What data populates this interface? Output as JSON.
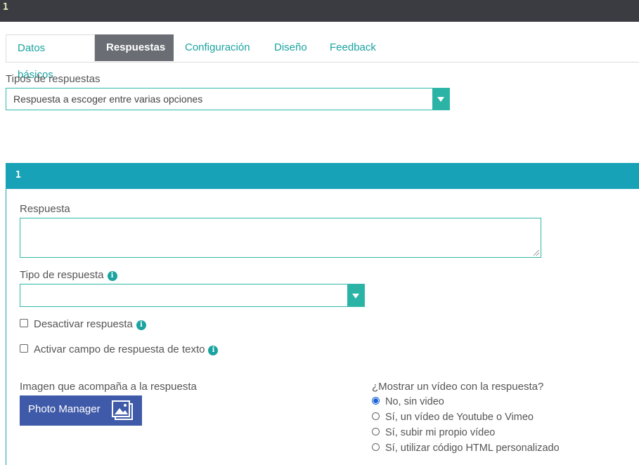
{
  "topbar": {
    "number": "1"
  },
  "tabs": [
    {
      "label": "Datos básicos"
    },
    {
      "label": "Respuestas"
    },
    {
      "label": "Configuración"
    },
    {
      "label": "Diseño"
    },
    {
      "label": "Feedback"
    }
  ],
  "response_types": {
    "label": "Tipos de respuestas",
    "selected": "Respuesta a escoger entre varias opciones"
  },
  "answer_panel": {
    "number": "1",
    "answer_label": "Respuesta",
    "answer_value": "",
    "type_label": "Tipo de respuesta",
    "type_selected": "",
    "disable_label": "Desactivar respuesta",
    "text_field_label": "Activar campo de respuesta de texto",
    "image_label": "Imagen que acompaña a la respuesta",
    "photo_button": "Photo Manager",
    "video_question": "¿Mostrar un vídeo con la respuesta?",
    "video_options": [
      {
        "label": "No, sin video",
        "checked": true
      },
      {
        "label": "Sí, un vídeo de Youtube o Vimeo",
        "checked": false
      },
      {
        "label": "Sí, subir mi propio vídeo",
        "checked": false
      },
      {
        "label": "Sí, utilizar código HTML personalizado",
        "checked": false
      }
    ]
  },
  "colors": {
    "accent": "#1aa3a0",
    "panel_header": "#17a2b8",
    "active_tab": "#6a6e74",
    "photo_button": "#3f5aa8"
  }
}
